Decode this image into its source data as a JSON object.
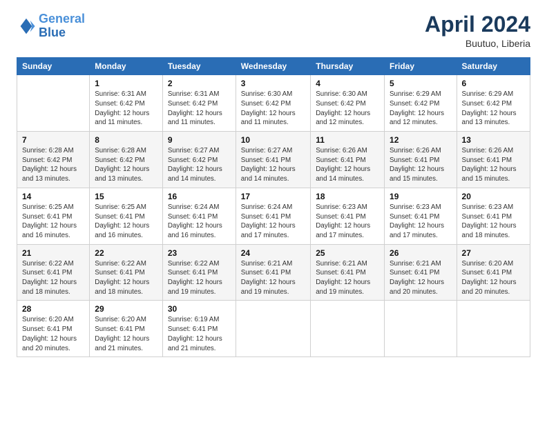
{
  "header": {
    "logo_line1": "General",
    "logo_line2": "Blue",
    "month": "April 2024",
    "location": "Buutuo, Liberia"
  },
  "weekdays": [
    "Sunday",
    "Monday",
    "Tuesday",
    "Wednesday",
    "Thursday",
    "Friday",
    "Saturday"
  ],
  "weeks": [
    [
      {
        "day": "",
        "info": ""
      },
      {
        "day": "1",
        "info": "Sunrise: 6:31 AM\nSunset: 6:42 PM\nDaylight: 12 hours\nand 11 minutes."
      },
      {
        "day": "2",
        "info": "Sunrise: 6:31 AM\nSunset: 6:42 PM\nDaylight: 12 hours\nand 11 minutes."
      },
      {
        "day": "3",
        "info": "Sunrise: 6:30 AM\nSunset: 6:42 PM\nDaylight: 12 hours\nand 11 minutes."
      },
      {
        "day": "4",
        "info": "Sunrise: 6:30 AM\nSunset: 6:42 PM\nDaylight: 12 hours\nand 12 minutes."
      },
      {
        "day": "5",
        "info": "Sunrise: 6:29 AM\nSunset: 6:42 PM\nDaylight: 12 hours\nand 12 minutes."
      },
      {
        "day": "6",
        "info": "Sunrise: 6:29 AM\nSunset: 6:42 PM\nDaylight: 12 hours\nand 13 minutes."
      }
    ],
    [
      {
        "day": "7",
        "info": "Sunrise: 6:28 AM\nSunset: 6:42 PM\nDaylight: 12 hours\nand 13 minutes."
      },
      {
        "day": "8",
        "info": "Sunrise: 6:28 AM\nSunset: 6:42 PM\nDaylight: 12 hours\nand 13 minutes."
      },
      {
        "day": "9",
        "info": "Sunrise: 6:27 AM\nSunset: 6:42 PM\nDaylight: 12 hours\nand 14 minutes."
      },
      {
        "day": "10",
        "info": "Sunrise: 6:27 AM\nSunset: 6:41 PM\nDaylight: 12 hours\nand 14 minutes."
      },
      {
        "day": "11",
        "info": "Sunrise: 6:26 AM\nSunset: 6:41 PM\nDaylight: 12 hours\nand 14 minutes."
      },
      {
        "day": "12",
        "info": "Sunrise: 6:26 AM\nSunset: 6:41 PM\nDaylight: 12 hours\nand 15 minutes."
      },
      {
        "day": "13",
        "info": "Sunrise: 6:26 AM\nSunset: 6:41 PM\nDaylight: 12 hours\nand 15 minutes."
      }
    ],
    [
      {
        "day": "14",
        "info": "Sunrise: 6:25 AM\nSunset: 6:41 PM\nDaylight: 12 hours\nand 16 minutes."
      },
      {
        "day": "15",
        "info": "Sunrise: 6:25 AM\nSunset: 6:41 PM\nDaylight: 12 hours\nand 16 minutes."
      },
      {
        "day": "16",
        "info": "Sunrise: 6:24 AM\nSunset: 6:41 PM\nDaylight: 12 hours\nand 16 minutes."
      },
      {
        "day": "17",
        "info": "Sunrise: 6:24 AM\nSunset: 6:41 PM\nDaylight: 12 hours\nand 17 minutes."
      },
      {
        "day": "18",
        "info": "Sunrise: 6:23 AM\nSunset: 6:41 PM\nDaylight: 12 hours\nand 17 minutes."
      },
      {
        "day": "19",
        "info": "Sunrise: 6:23 AM\nSunset: 6:41 PM\nDaylight: 12 hours\nand 17 minutes."
      },
      {
        "day": "20",
        "info": "Sunrise: 6:23 AM\nSunset: 6:41 PM\nDaylight: 12 hours\nand 18 minutes."
      }
    ],
    [
      {
        "day": "21",
        "info": "Sunrise: 6:22 AM\nSunset: 6:41 PM\nDaylight: 12 hours\nand 18 minutes."
      },
      {
        "day": "22",
        "info": "Sunrise: 6:22 AM\nSunset: 6:41 PM\nDaylight: 12 hours\nand 18 minutes."
      },
      {
        "day": "23",
        "info": "Sunrise: 6:22 AM\nSunset: 6:41 PM\nDaylight: 12 hours\nand 19 minutes."
      },
      {
        "day": "24",
        "info": "Sunrise: 6:21 AM\nSunset: 6:41 PM\nDaylight: 12 hours\nand 19 minutes."
      },
      {
        "day": "25",
        "info": "Sunrise: 6:21 AM\nSunset: 6:41 PM\nDaylight: 12 hours\nand 19 minutes."
      },
      {
        "day": "26",
        "info": "Sunrise: 6:21 AM\nSunset: 6:41 PM\nDaylight: 12 hours\nand 20 minutes."
      },
      {
        "day": "27",
        "info": "Sunrise: 6:20 AM\nSunset: 6:41 PM\nDaylight: 12 hours\nand 20 minutes."
      }
    ],
    [
      {
        "day": "28",
        "info": "Sunrise: 6:20 AM\nSunset: 6:41 PM\nDaylight: 12 hours\nand 20 minutes."
      },
      {
        "day": "29",
        "info": "Sunrise: 6:20 AM\nSunset: 6:41 PM\nDaylight: 12 hours\nand 21 minutes."
      },
      {
        "day": "30",
        "info": "Sunrise: 6:19 AM\nSunset: 6:41 PM\nDaylight: 12 hours\nand 21 minutes."
      },
      {
        "day": "",
        "info": ""
      },
      {
        "day": "",
        "info": ""
      },
      {
        "day": "",
        "info": ""
      },
      {
        "day": "",
        "info": ""
      }
    ]
  ]
}
